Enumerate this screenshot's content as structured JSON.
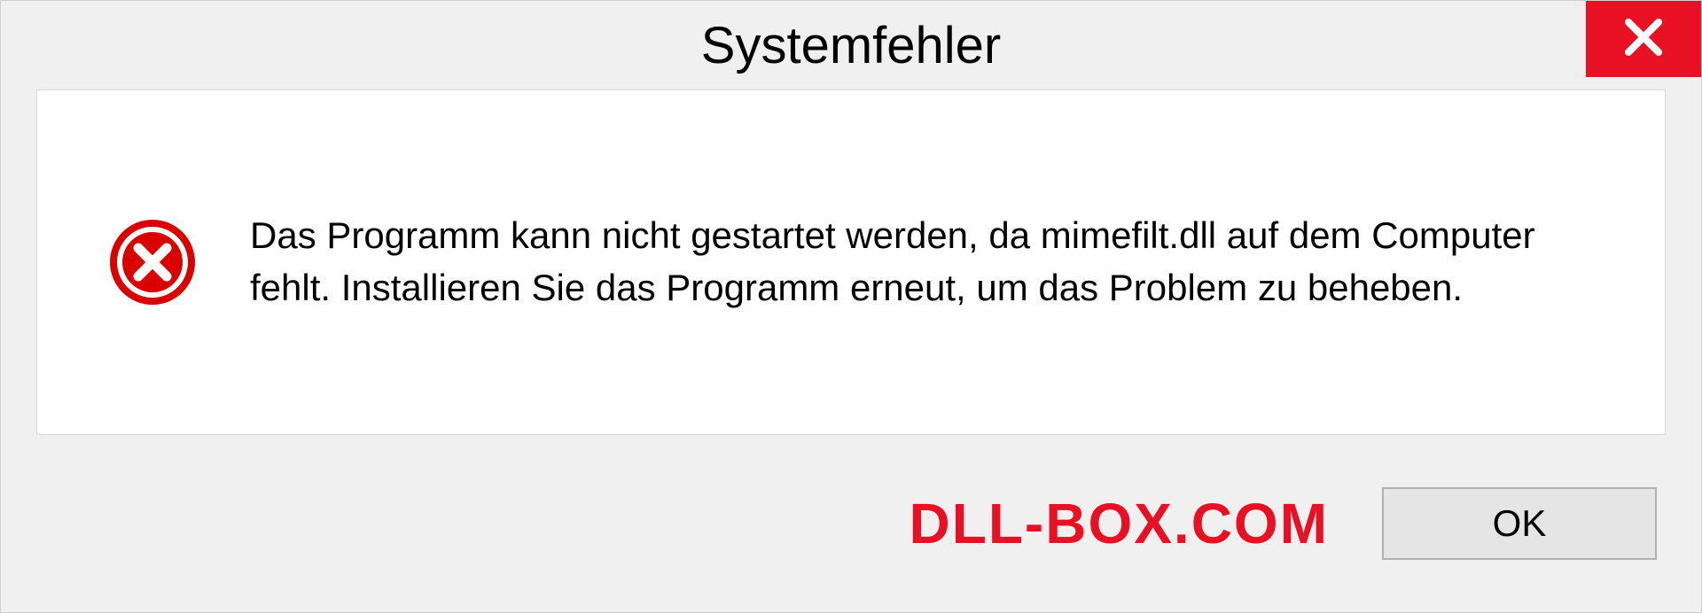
{
  "dialog": {
    "title": "Systemfehler",
    "message": "Das Programm kann nicht gestartet werden, da mimefilt.dll auf dem Computer fehlt. Installieren Sie das Programm erneut, um das Problem zu beheben.",
    "ok_label": "OK"
  },
  "watermark": "DLL-BOX.COM",
  "colors": {
    "close_bg": "#e81123",
    "error_icon": "#d90000",
    "watermark": "#e81123"
  }
}
